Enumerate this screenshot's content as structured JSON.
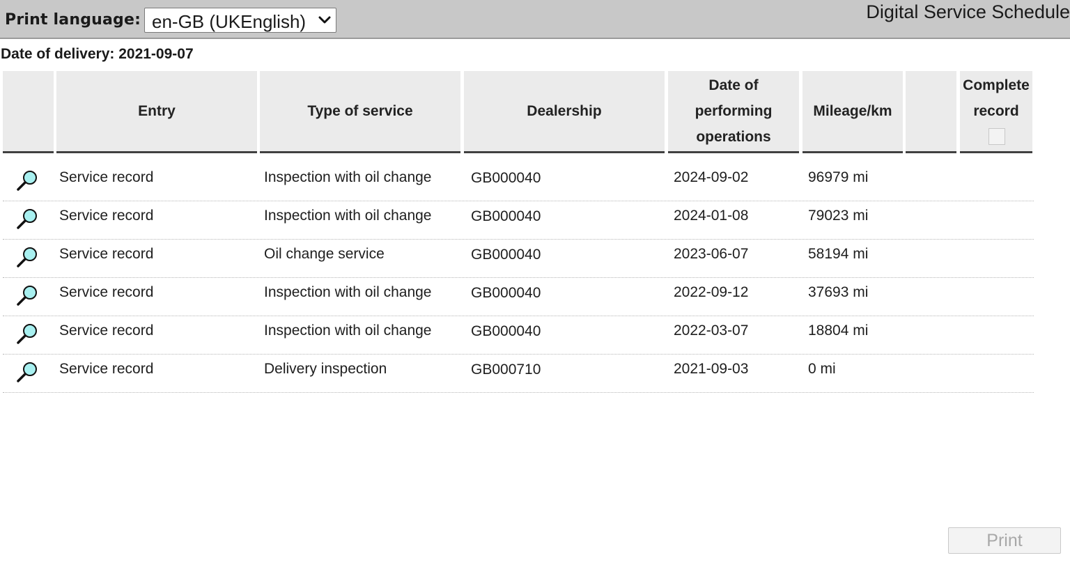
{
  "header": {
    "print_language_label": "Print language:",
    "print_language_value": "en-GB (UKEnglish)",
    "app_title": "Digital Service Schedule"
  },
  "delivery": {
    "label": "Date of delivery: 2021-09-07"
  },
  "table": {
    "columns": [
      "",
      "Entry",
      "Type of service",
      "Dealership",
      "Date of performing operations",
      "Mileage/km",
      "",
      "Complete record"
    ],
    "rows": [
      {
        "entry": "Service record",
        "type": "Inspection with oil change",
        "dealership": "GB000040",
        "date": "2024-09-02",
        "mileage": "96979 mi"
      },
      {
        "entry": "Service record",
        "type": "Inspection with oil change",
        "dealership": "GB000040",
        "date": "2024-01-08",
        "mileage": "79023 mi"
      },
      {
        "entry": "Service record",
        "type": "Oil change service",
        "dealership": "GB000040",
        "date": "2023-06-07",
        "mileage": "58194 mi"
      },
      {
        "entry": "Service record",
        "type": "Inspection with oil change",
        "dealership": "GB000040",
        "date": "2022-09-12",
        "mileage": "37693 mi"
      },
      {
        "entry": "Service record",
        "type": "Inspection with oil change",
        "dealership": "GB000040",
        "date": "2022-03-07",
        "mileage": "18804 mi"
      },
      {
        "entry": "Service record",
        "type": "Delivery inspection",
        "dealership": "GB000710",
        "date": "2021-09-03",
        "mileage": "0 mi"
      }
    ]
  },
  "footer": {
    "print_label": "Print"
  },
  "icons": {
    "view": "magnifier-icon",
    "select_chevron": "chevron-down-icon"
  },
  "colors": {
    "topbar": "#c8c8c8",
    "header_cell": "#ebebeb",
    "magnifier_lens": "#a8f0f0"
  }
}
